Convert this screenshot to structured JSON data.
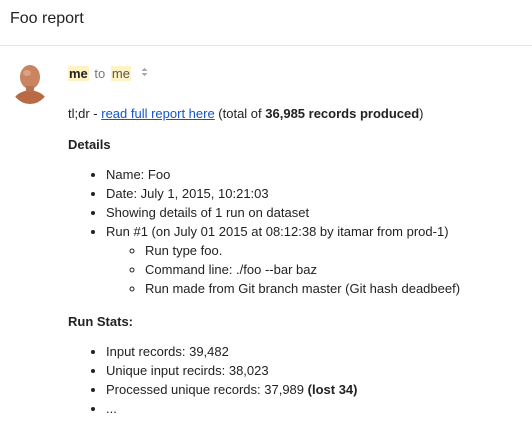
{
  "subject": "Foo report",
  "from_line": {
    "sender": "me",
    "to_word": "to",
    "recipient": "me",
    "caret_icon": "caret-updown-icon"
  },
  "body": {
    "tldr_prefix": "tl;dr - ",
    "tldr_link": "read full report here",
    "tldr_mid": " (total of ",
    "tldr_bold": "36,985 records produced",
    "tldr_suffix": ")",
    "details_title": "Details",
    "details": {
      "name": "Name: Foo",
      "date": "Date: July 1, 2015, 10:21:03",
      "showing": "Showing details of 1 run on dataset",
      "run": "Run #1 (on July 01 2015 at 08:12:38 by itamar from prod-1)",
      "run_sub": [
        "Run type foo.",
        "Command line: ./foo --bar baz",
        "Run made from Git branch master (Git hash deadbeef)"
      ]
    },
    "run_stats_title": "Run Stats:",
    "stats": {
      "input": "Input records: 39,482",
      "unique": "Unique input recirds: 38,023",
      "processed": "Processed unique records: 37,989 ",
      "processed_bold": "(lost 34)",
      "ellipsis": "..."
    }
  }
}
